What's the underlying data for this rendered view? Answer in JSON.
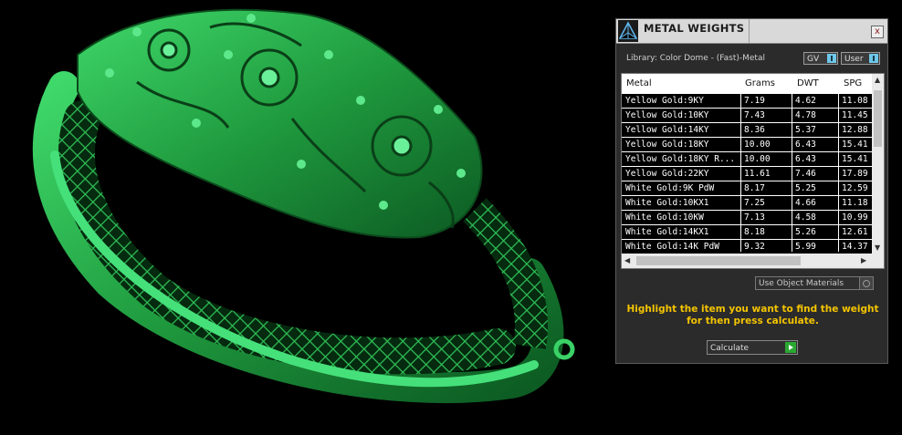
{
  "panel": {
    "title": "METAL WEIGHTS",
    "close_label": "x",
    "library": "Library: Color Dome - (Fast)-Metal",
    "toggle_gv": "GV",
    "toggle_user": "User",
    "use_materials": "Use Object Materials",
    "instruction": "Highlight the item you want to find the weight for then press calculate.",
    "calculate": "Calculate"
  },
  "table": {
    "headers": [
      "Metal",
      "Grams",
      "DWT",
      "SPG"
    ],
    "rows": [
      [
        "Yellow Gold:9KY",
        "7.19",
        "4.62",
        "11.08"
      ],
      [
        "Yellow Gold:10KY",
        "7.43",
        "4.78",
        "11.45"
      ],
      [
        "Yellow Gold:14KY",
        "8.36",
        "5.37",
        "12.88"
      ],
      [
        "Yellow Gold:18KY",
        "10.00",
        "6.43",
        "15.41"
      ],
      [
        "Yellow Gold:18KY R...",
        "10.00",
        "6.43",
        "15.41"
      ],
      [
        "Yellow Gold:22KY",
        "11.61",
        "7.46",
        "17.89"
      ],
      [
        "White Gold:9K PdW",
        "8.17",
        "5.25",
        "12.59"
      ],
      [
        "White Gold:10KX1",
        "7.25",
        "4.66",
        "11.18"
      ],
      [
        "White Gold:10KW",
        "7.13",
        "4.58",
        "10.99"
      ],
      [
        "White Gold:14KX1",
        "8.18",
        "5.26",
        "12.61"
      ],
      [
        "White Gold:14K PdW",
        "9.32",
        "5.99",
        "14.37"
      ]
    ]
  },
  "colors": {
    "model": "#22a844",
    "instruction": "#f4c400",
    "go_button": "#2aa832"
  }
}
